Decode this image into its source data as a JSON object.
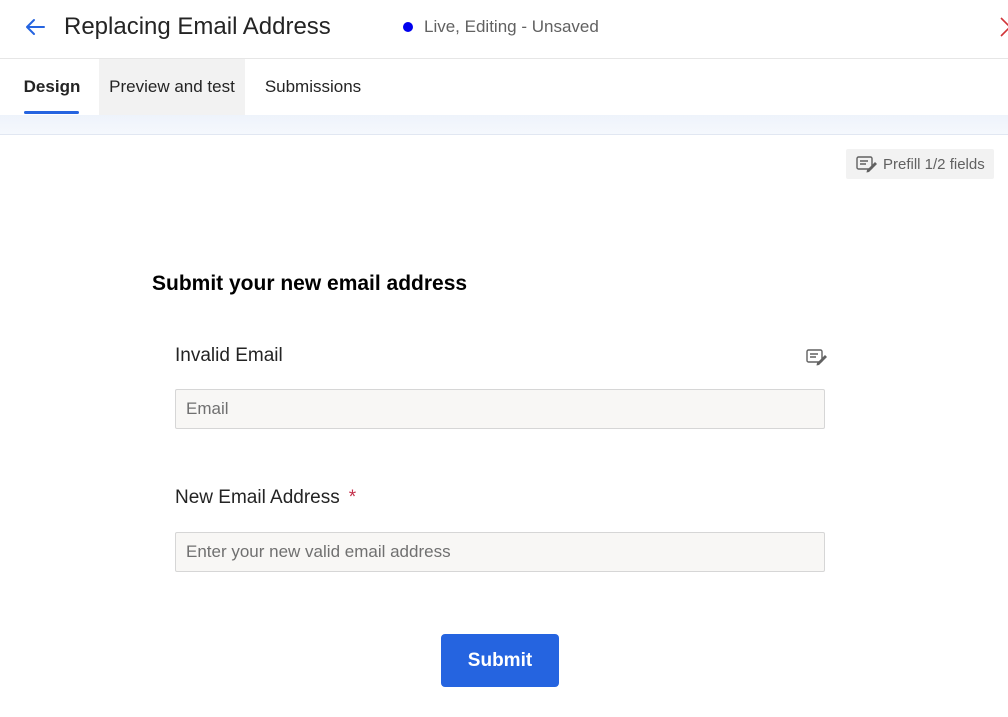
{
  "header": {
    "title": "Replacing Email Address",
    "status": "Live, Editing - Unsaved",
    "back_icon": "arrow-left-icon",
    "close_icon": "close-icon"
  },
  "tabs": [
    {
      "label": "Design",
      "active": true
    },
    {
      "label": "Preview and test",
      "active": false
    },
    {
      "label": "Submissions",
      "active": false
    }
  ],
  "prefill": {
    "label": "Prefill 1/2 fields",
    "icon": "prefill-edit-icon"
  },
  "form": {
    "heading": "Submit your new email address",
    "fields": [
      {
        "label": "Invalid Email",
        "placeholder": "Email",
        "required": false,
        "prefill_icon": "prefill-edit-icon"
      },
      {
        "label": "New Email Address",
        "placeholder": "Enter your new valid email address",
        "required": true,
        "required_mark": "*"
      }
    ],
    "submit_label": "Submit"
  },
  "colors": {
    "accent": "#2564e0",
    "status_dot": "#0000ee",
    "required": "#c4314b",
    "close": "#d13438"
  }
}
